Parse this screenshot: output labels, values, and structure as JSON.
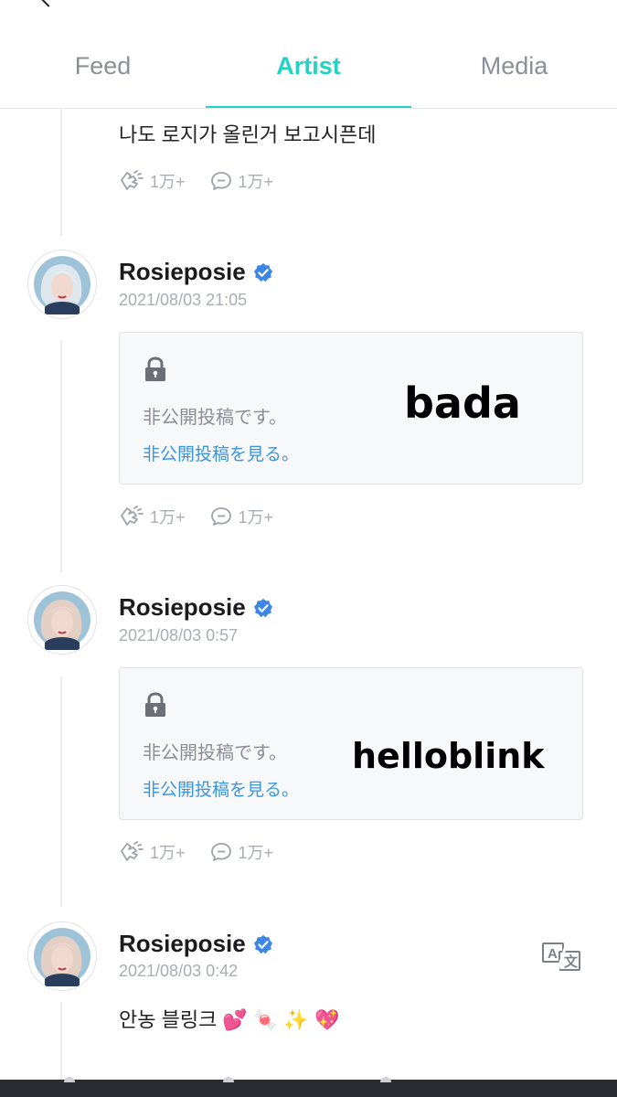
{
  "tabs": [
    {
      "label": "Feed",
      "active": false
    },
    {
      "label": "Artist",
      "active": true
    },
    {
      "label": "Media",
      "active": false
    }
  ],
  "colors": {
    "accent": "#20d3c2",
    "link": "#3b95df",
    "verified": "#3b86e6"
  },
  "prev_post": {
    "text": "나도 로지가 올린거 보고시픈데",
    "likes": "1万+",
    "comments": "1万+"
  },
  "posts": [
    {
      "author": "Rosieposie",
      "date": "2021/08/03 21:05",
      "private_text": "非公開投稿です。",
      "private_link": "非公開投稿を見る。",
      "overlay": "bada",
      "likes": "1万+",
      "comments": "1万+"
    },
    {
      "author": "Rosieposie",
      "date": "2021/08/03 0:57",
      "private_text": "非公開投稿です。",
      "private_link": "非公開投稿を見る。",
      "overlay": "helloblink",
      "likes": "1万+",
      "comments": "1万+"
    },
    {
      "author": "Rosieposie",
      "date": "2021/08/03 0:42",
      "text": "안농 블링크 💕 🍬 ✨ 💖"
    }
  ],
  "icons": {
    "back": "chevron-left-icon",
    "verified": "verified-badge-icon",
    "lock": "lock-icon",
    "like": "hands-like-icon",
    "comment": "comment-bubble-icon",
    "translate": "translate-icon"
  }
}
